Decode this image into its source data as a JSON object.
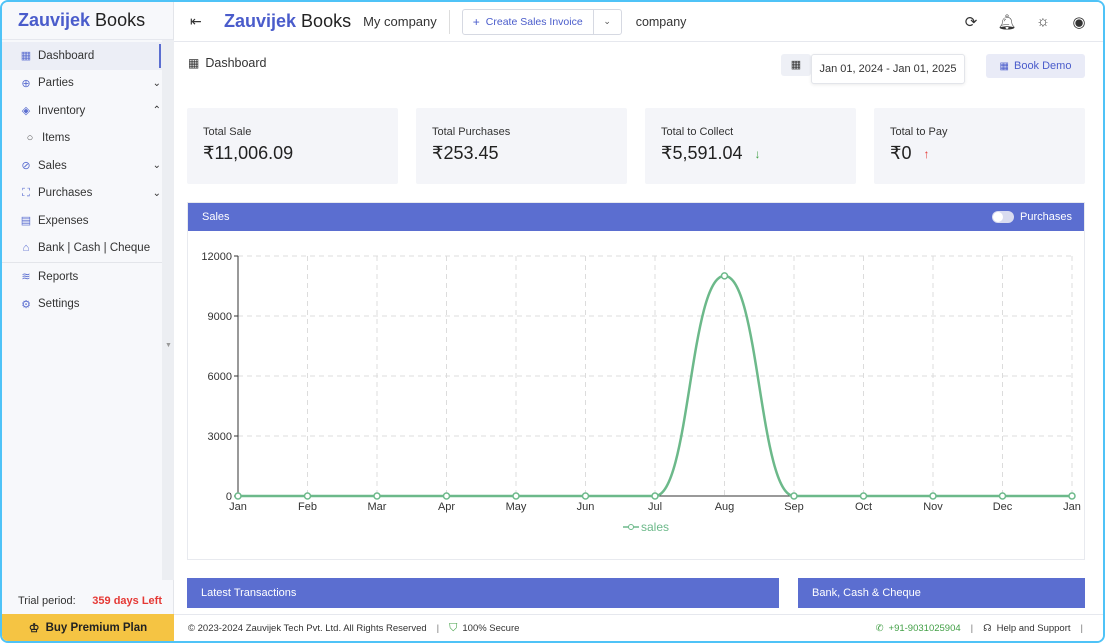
{
  "sidebar": {
    "brand_part1": "Zauvijek",
    "brand_part2": " Books",
    "items": [
      {
        "label": "Dashboard",
        "icon": "grid-icon",
        "glyph": "▦"
      },
      {
        "label": "Parties",
        "icon": "globe-icon",
        "glyph": "⊕",
        "chevron": "⌄"
      },
      {
        "label": "Inventory",
        "icon": "cube-icon",
        "glyph": "◈",
        "chevron": "⌃"
      },
      {
        "label": "Items",
        "icon": "circle-icon",
        "glyph": "○"
      },
      {
        "label": "Sales",
        "icon": "check-circle-icon",
        "glyph": "⊘",
        "chevron": "⌄"
      },
      {
        "label": "Purchases",
        "icon": "cart-icon",
        "glyph": "⛶",
        "chevron": "⌄"
      },
      {
        "label": "Expenses",
        "icon": "table-icon",
        "glyph": "▤"
      },
      {
        "label": "Bank | Cash | Cheque",
        "icon": "bank-icon",
        "glyph": "⌂"
      },
      {
        "label": "Reports",
        "icon": "layers-icon",
        "glyph": "≋"
      },
      {
        "label": "Settings",
        "icon": "gear-icon",
        "glyph": "⚙"
      }
    ],
    "trial_label": "Trial period:",
    "trial_days": "359 days Left",
    "premium_label": "Buy Premium Plan"
  },
  "topbar": {
    "brand_part1": "Zauvijek",
    "brand_part2": " Books",
    "company": "My company",
    "create_label": "Create Sales Invoice",
    "company2": "company"
  },
  "content": {
    "breadcrumb": "Dashboard",
    "date_range": "Jan 01, 2024 - Jan 01, 2025",
    "book_demo": "Book Demo",
    "cards": [
      {
        "title": "Total Sale",
        "value": "₹11,006.09",
        "arrow": ""
      },
      {
        "title": "Total Purchases",
        "value": "₹253.45",
        "arrow": ""
      },
      {
        "title": "Total to Collect",
        "value": "₹5,591.04",
        "arrow": "down"
      },
      {
        "title": "Total to Pay",
        "value": "₹0",
        "arrow": "up"
      }
    ],
    "sales_title": "Sales",
    "purchases_toggle": "Purchases",
    "latest_title": "Latest Transactions",
    "bcc_title": "Bank, Cash & Cheque"
  },
  "chart_data": {
    "type": "line",
    "title": "",
    "xlabel": "",
    "ylabel": "",
    "categories": [
      "Jan",
      "Feb",
      "Mar",
      "Apr",
      "May",
      "Jun",
      "Jul",
      "Aug",
      "Sep",
      "Oct",
      "Nov",
      "Dec",
      "Jan"
    ],
    "series": [
      {
        "name": "sales",
        "values": [
          0,
          0,
          0,
          0,
          0,
          0,
          0,
          11006.09,
          0,
          0,
          0,
          0,
          0
        ]
      }
    ],
    "yticks": [
      0,
      3000,
      6000,
      9000,
      12000
    ],
    "ylim": [
      0,
      12000
    ],
    "grid": true,
    "legend": "bottom-center",
    "color": "#6cb98a"
  },
  "footer": {
    "copyright": "© 2023-2024 Zauvijek Tech Pvt. Ltd. All Rights Reserved",
    "secure": "100% Secure",
    "phone": "+91-9031025904",
    "help": "Help and Support"
  }
}
